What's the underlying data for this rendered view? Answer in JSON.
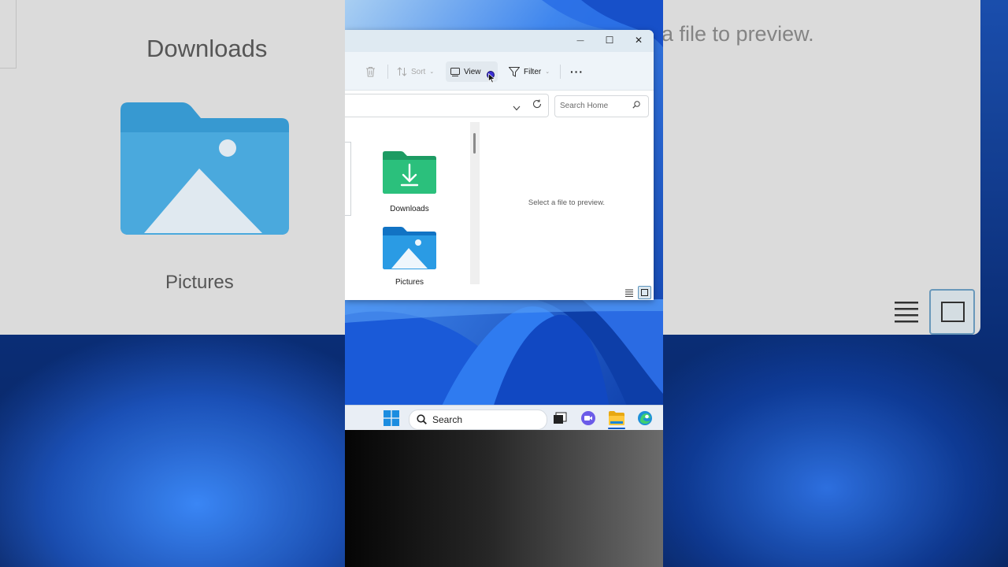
{
  "background": {
    "folder_label_downloads": "Downloads",
    "folder_label_pictures": "Pictures",
    "preview_text": "a file to preview."
  },
  "window": {
    "controls": {
      "minimize": "—",
      "maximize": "☐",
      "close": "✕"
    },
    "command_bar": {
      "sort_label": "Sort",
      "view_label": "View",
      "filter_label": "Filter",
      "more_label": "···"
    },
    "search": {
      "placeholder": "Search Home"
    },
    "folders": [
      {
        "name": "Downloads",
        "icon": "downloads-folder-icon"
      },
      {
        "name": "Pictures",
        "icon": "pictures-folder-icon"
      }
    ],
    "preview_pane": {
      "message": "Select a file to preview."
    }
  },
  "taskbar": {
    "search_label": "Search",
    "icons": [
      "start-icon",
      "task-view-icon",
      "teams-chat-icon",
      "file-explorer-icon",
      "edge-icon"
    ]
  },
  "colors": {
    "accent": "#0a5ac8",
    "downloads_folder": "#2bb37a",
    "pictures_folder": "#1a86d6"
  }
}
